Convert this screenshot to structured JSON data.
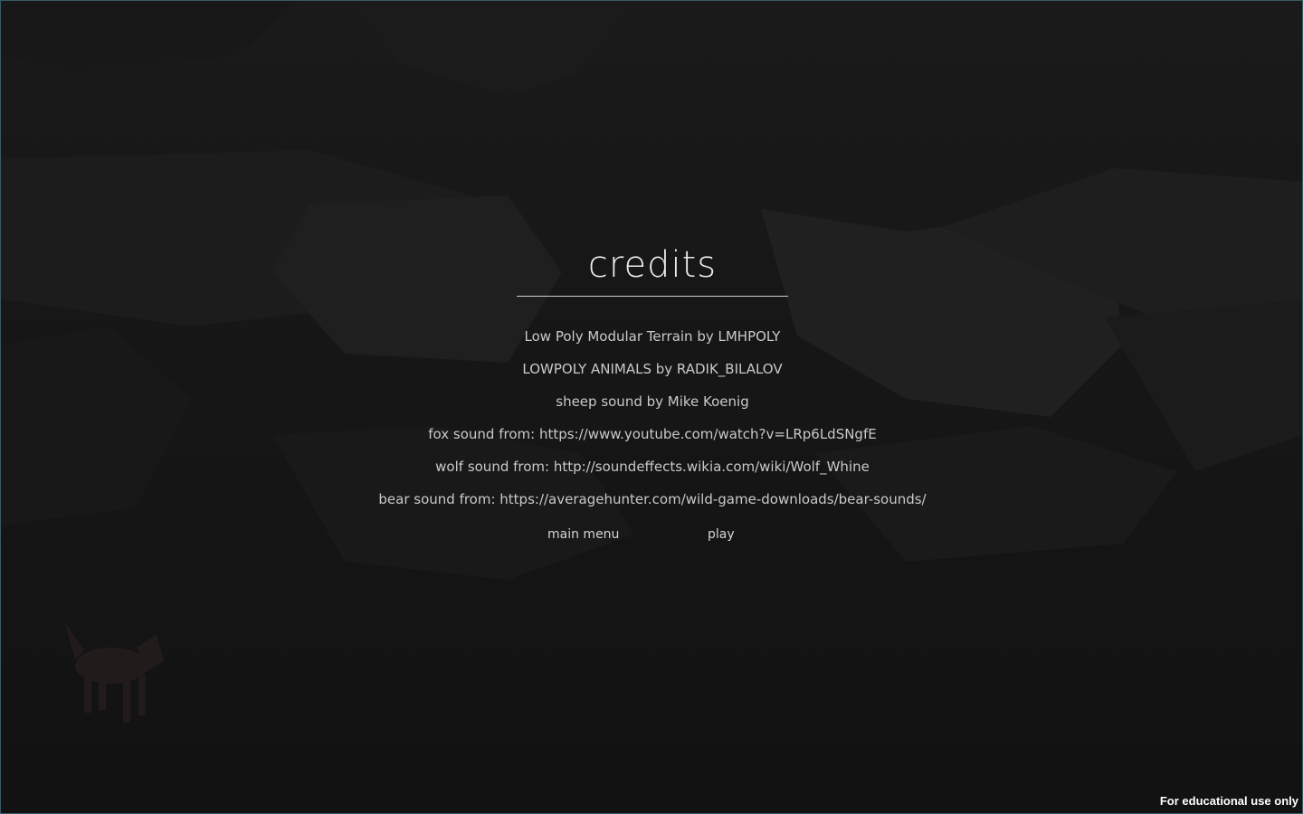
{
  "title": "credits",
  "credits": [
    "Low Poly Modular Terrain by LMHPOLY",
    "LOWPOLY ANIMALS by RADIK_BILALOV",
    "sheep sound by Mike Koenig",
    "fox sound from: https://www.youtube.com/watch?v=LRp6LdSNgfE",
    "wolf sound from: http://soundeffects.wikia.com/wiki/Wolf_Whine",
    "bear sound from: https://averagehunter.com/wild-game-downloads/bear-sounds/"
  ],
  "buttons": {
    "main_menu": "main menu",
    "play": "play"
  },
  "watermark": "For educational use only",
  "colors": {
    "background": "#121212",
    "text": "#c9c9c9",
    "title": "#ececec",
    "frame": "#3a5a66"
  }
}
